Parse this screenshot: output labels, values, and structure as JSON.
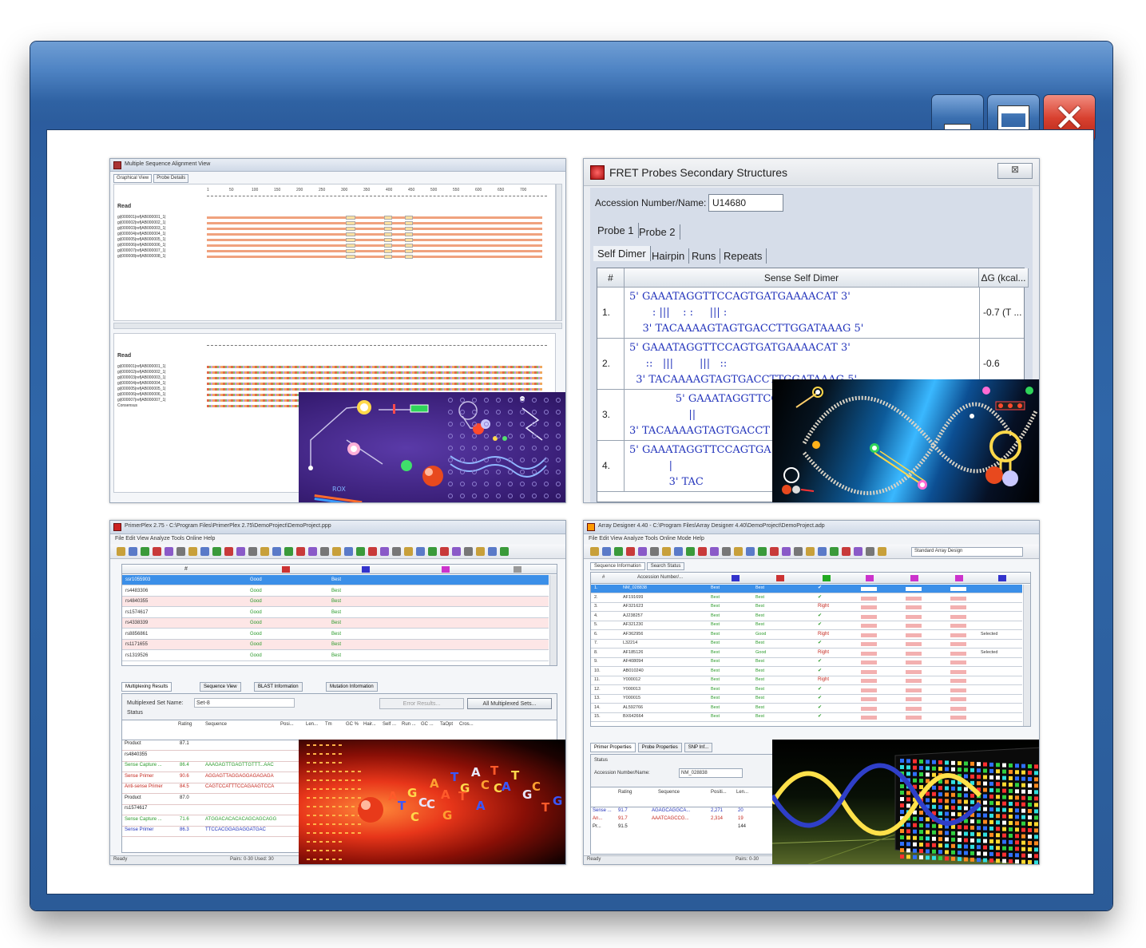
{
  "window": {
    "buttons": {
      "minimize": "minimize",
      "maximize": "maximize",
      "close": "✕"
    }
  },
  "msa": {
    "title": "Multiple Sequence Alignment View",
    "tabs": [
      "Graphical View",
      "Probe Details"
    ],
    "ruler_top": [
      "1",
      "50",
      "100",
      "150",
      "200",
      "250",
      "300",
      "350",
      "400",
      "450",
      "500",
      "550",
      "600",
      "650",
      "700"
    ],
    "consensus_label": "Read",
    "rows_top": [
      "gi|000001|ref|AB000001_1|",
      "gi|000002|ref|AB000002_1|",
      "gi|000003|ref|AB000003_1|",
      "gi|000004|ref|AB000004_1|",
      "gi|000005|ref|AB000005_1|",
      "gi|000006|ref|AB000006_1|",
      "gi|000007|ref|AB000007_1|",
      "gi|000008|ref|AB000008_1|"
    ],
    "rows_bottom": [
      "gi|000001|ref|AB000001_1|",
      "gi|000002|ref|AB000002_1|",
      "gi|000003|ref|AB000003_1|",
      "gi|000004|ref|AB000004_1|",
      "gi|000005|ref|AB000005_1|",
      "gi|000006|ref|AB000006_1|",
      "gi|000007|ref|AB000007_1|",
      "Consensus"
    ]
  },
  "fret": {
    "title": "FRET Probes Secondary Structures",
    "close_label": "⊠",
    "accession_label": "Accession Number/Name:",
    "accession_value": "U14680",
    "probe_tabs": [
      "Probe 1",
      "Probe 2"
    ],
    "struct_tabs": [
      "Self Dimer",
      "Hairpin",
      "Runs",
      "Repeats"
    ],
    "headers": {
      "num": "#",
      "dimer": "Sense Self Dimer",
      "dg": "ΔG (kcal..."
    },
    "rows": [
      {
        "n": "1.",
        "l1": "5' GAAATAGGTTCCAGTGATGAAAACAT 3'",
        "l2": "       : |||    : :     ||| :",
        "l3": "    3' TACAAAAGTAGTGACCTTGGATAAAG 5'",
        "dg": "-0.7 (T ..."
      },
      {
        "n": "2.",
        "l1": "5' GAAATAGGTTCCAGTGATGAAAACAT 3'",
        "l2": "     ::   |||        |||   ::",
        "l3": "  3' TACAAAAGTAGTGACCTTGGATAAAG 5'",
        "dg": "-0.6"
      },
      {
        "n": "3.",
        "l1": "              5' GAAATAGGTTCCAGTGATG",
        "l2": "                  ||",
        "l3": "3' TACAAAAGTAGTGACCT",
        "dg": ""
      },
      {
        "n": "4.",
        "l1": "5' GAAATAGGTTCCAGTGA",
        "l2": "            |",
        "l3": "            3' TAC",
        "dg": ""
      }
    ]
  },
  "primerplex": {
    "title": "PrimerPlex 2.75 - C:\\Program Files\\PrimerPlex 2.75\\DemoProject\\DemoProject.ppp",
    "menu": "File  Edit  View  Analyze  Tools  Online  Help",
    "col_num": "#",
    "rows": [
      {
        "id": "ssr1055903",
        "a": "Good",
        "b": "Best"
      },
      {
        "id": "rs4483306",
        "a": "Good",
        "b": "Best"
      },
      {
        "id": "rs4840355",
        "a": "Good",
        "b": "Best"
      },
      {
        "id": "rs1574617",
        "a": "Good",
        "b": "Best"
      },
      {
        "id": "rs4338339",
        "a": "Good",
        "b": "Best"
      },
      {
        "id": "rs8856861",
        "a": "Good",
        "b": "Best"
      },
      {
        "id": "rs1171655",
        "a": "Good",
        "b": "Best"
      },
      {
        "id": "rs1319526",
        "a": "Good",
        "b": "Best"
      }
    ],
    "tabs": [
      "Multiplexing Results",
      "Sequence View",
      "BLAST Information",
      "Mutation Information"
    ],
    "set_label": "Multiplexed Set Name:",
    "set_value": "Set-8",
    "status_label": "Status",
    "btn_error": "Error Results...",
    "btn_all": "All Multiplexed Sets...",
    "res_headers": [
      "Rating",
      "Sequence",
      "Posi...",
      "Len...",
      "Tm",
      "GC %",
      "Hair...",
      "Self ...",
      "Run ...",
      "GC ...",
      "TaOpt",
      "Cros..."
    ],
    "res_rows": [
      {
        "label": "Product",
        "rating": "87.1",
        "seq": "",
        "color": "#222"
      },
      {
        "label": "rs4840355",
        "rating": "",
        "seq": "",
        "color": "#222"
      },
      {
        "label": "Sense Capture ...",
        "rating": "86.4",
        "seq": "AAAGAGTTGAGTTGTTT...AAC",
        "color": "#2a9a2a"
      },
      {
        "label": "Sense Primer",
        "rating": "90.6",
        "seq": "AGGAGTTAGGAGGAGAGAGA",
        "color": "#c4261c"
      },
      {
        "label": "Anti-sense Primer",
        "rating": "84.5",
        "seq": "CAGTCCATTTCCAGAAGTCCA",
        "color": "#c4261c"
      },
      {
        "label": "Product",
        "rating": "87.0",
        "seq": "",
        "color": "#222"
      },
      {
        "label": "rs1574617",
        "rating": "",
        "seq": "",
        "color": "#222"
      },
      {
        "label": "Sense Capture ...",
        "rating": "71.6",
        "seq": "ATGGACACACACAGCAGCAGG",
        "color": "#2a9a2a"
      },
      {
        "label": "Sense Primer",
        "rating": "86.3",
        "seq": "TTCCACGGAGAGGATGAC",
        "color": "#2233bb"
      }
    ],
    "status": "Ready",
    "status_right": "Pairs: 0-30 Used: 30"
  },
  "arraydesigner": {
    "title": "Array Designer 4.40 - C:\\Program Files\\Array Designer 4.40\\DemoProject\\DemoProject.adp",
    "menu": "File  Edit  View  Analyze  Tools  Online  Mode  Help",
    "design_select": "Standard Array Design",
    "tabs": [
      "Sequence Information",
      "Search Status"
    ],
    "headers": {
      "num": "#",
      "acc": "Accession Number/..."
    },
    "rows": [
      {
        "n": "1.",
        "acc": "NM_028838",
        "a": "Best",
        "b": "Best",
        "ok": "✔",
        "sel": ""
      },
      {
        "n": "2.",
        "acc": "AF191699",
        "a": "Best",
        "b": "Best",
        "ok": "✔",
        "sel": ""
      },
      {
        "n": "3.",
        "acc": "AF321623",
        "a": "Best",
        "b": "Best",
        "ok": "Right",
        "sel": ""
      },
      {
        "n": "4.",
        "acc": "AJ238257",
        "a": "Best",
        "b": "Best",
        "ok": "✔",
        "sel": ""
      },
      {
        "n": "5.",
        "acc": "AF321230",
        "a": "Best",
        "b": "Best",
        "ok": "✔",
        "sel": ""
      },
      {
        "n": "6.",
        "acc": "AF362956",
        "a": "Best",
        "b": "Good",
        "ok": "Right",
        "sel": "Selected"
      },
      {
        "n": "7.",
        "acc": "L32214",
        "a": "Best",
        "b": "Best",
        "ok": "✔",
        "sel": ""
      },
      {
        "n": "8.",
        "acc": "AF185126",
        "a": "Best",
        "b": "Good",
        "ok": "Right",
        "sel": "Selected"
      },
      {
        "n": "9.",
        "acc": "AF408094",
        "a": "Best",
        "b": "Best",
        "ok": "✔",
        "sel": ""
      },
      {
        "n": "10.",
        "acc": "AB010240",
        "a": "Best",
        "b": "Best",
        "ok": "✔",
        "sel": ""
      },
      {
        "n": "11.",
        "acc": "Y000012",
        "a": "Best",
        "b": "Best",
        "ok": "Right",
        "sel": ""
      },
      {
        "n": "12.",
        "acc": "Y000013",
        "a": "Best",
        "b": "Best",
        "ok": "✔",
        "sel": ""
      },
      {
        "n": "13.",
        "acc": "Y000015",
        "a": "Best",
        "b": "Best",
        "ok": "✔",
        "sel": ""
      },
      {
        "n": "14.",
        "acc": "AL592766",
        "a": "Best",
        "b": "Best",
        "ok": "✔",
        "sel": ""
      },
      {
        "n": "15.",
        "acc": "BX642664",
        "a": "Best",
        "b": "Best",
        "ok": "✔",
        "sel": ""
      }
    ],
    "bottom_tabs": [
      "Primer Properties",
      "Probe Properties",
      "SNP Inf..."
    ],
    "status_label": "Status",
    "acc_label": "Accession Number/Name:",
    "acc_value": "NM_028838",
    "bh": [
      "Rating",
      "Sequence",
      "Positi...",
      "Len..."
    ],
    "brows": [
      {
        "label": "Sense ...",
        "rating": "91.7",
        "seq": "AGAGCAGGCA...",
        "pos": "2,271",
        "len": "20",
        "color": "#2233bb"
      },
      {
        "label": "An...",
        "rating": "91.7",
        "seq": "AAATCAGCCG...",
        "pos": "2,314",
        "len": "19",
        "color": "#c4261c"
      },
      {
        "label": "Pr...",
        "rating": "91.5",
        "seq": "",
        "pos": "",
        "len": "144",
        "color": "#222"
      }
    ],
    "status": "Ready",
    "status_right": "Pairs: 0-30"
  },
  "art": {
    "purple_label": "ROX",
    "strand_letters": [
      "A",
      "T",
      "G",
      "C",
      "A",
      "A",
      "T",
      "G",
      "A",
      "C",
      "T",
      "A",
      "T",
      "G",
      "C",
      "T",
      "G",
      "C",
      "C",
      "G",
      "T",
      "A",
      "C"
    ]
  },
  "colors": {
    "frame": "#2f66a8",
    "close": "#d8402f"
  }
}
